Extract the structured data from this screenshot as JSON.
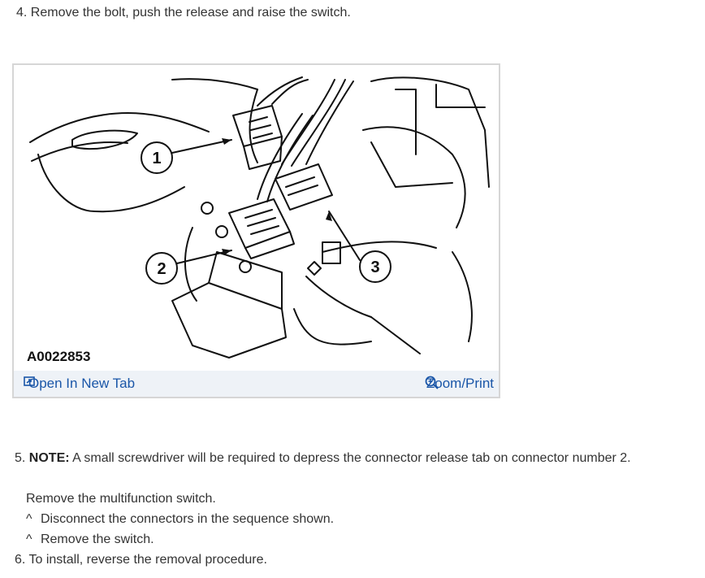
{
  "step4": {
    "number": "4.",
    "text": "Remove the bolt, push the release and raise the switch."
  },
  "figure": {
    "id_label": "A0022853",
    "callouts": [
      "1",
      "2",
      "3"
    ],
    "open_tab_label": "Open In New Tab",
    "zoom_print_label": "Zoom/Print",
    "link_color": "#1a56a8"
  },
  "step5": {
    "number": "5.",
    "note_label": "NOTE:",
    "note_text": "A small screwdriver will be required to depress the connector release tab on connector number 2.",
    "sub_heading": "Remove the multifunction switch.",
    "bullets": [
      {
        "marker": "^",
        "text": "Disconnect the connectors in the sequence shown."
      },
      {
        "marker": "^",
        "text": "Remove the switch."
      }
    ]
  },
  "step6": {
    "number": "6.",
    "text": "To install, reverse the removal procedure."
  }
}
